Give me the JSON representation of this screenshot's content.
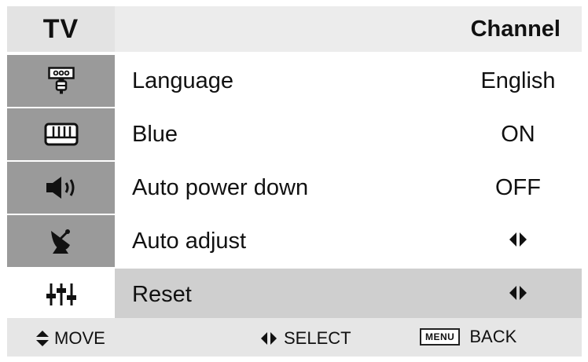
{
  "header": {
    "section": "TV",
    "title": "Channel"
  },
  "menu": {
    "items": [
      {
        "icon": "remote-icon",
        "label": "Language",
        "value": "English"
      },
      {
        "icon": "keyboard-icon",
        "label": "Blue",
        "value": "ON"
      },
      {
        "icon": "speaker-icon",
        "label": "Auto power down",
        "value": "OFF"
      },
      {
        "icon": "satellite-icon",
        "label": "Auto adjust",
        "value_icon": "left-right-arrows-icon"
      },
      {
        "icon": "equalizer-icon",
        "label": "Reset",
        "value_icon": "left-right-arrows-icon",
        "selected": true
      }
    ]
  },
  "footer": {
    "move": "MOVE",
    "select": "SELECT",
    "menu_key": "MENU",
    "back": "BACK"
  }
}
